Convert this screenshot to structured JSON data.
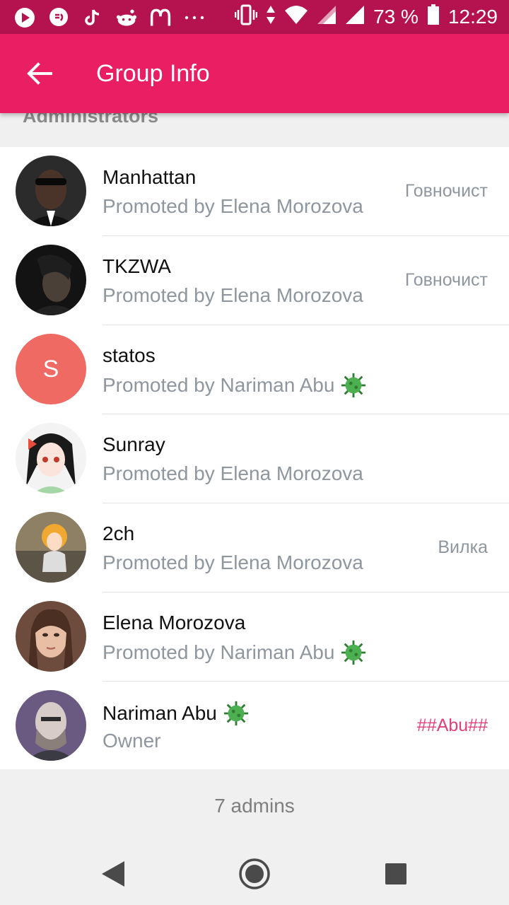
{
  "status_bar": {
    "battery_percent": "73 %",
    "time": "12:29",
    "left_icons": [
      "play-icon",
      "messenger-icon",
      "tiktok-icon",
      "reddit-icon",
      "mcdonalds-icon",
      "more-icon"
    ],
    "right_icons": [
      "vibrate-icon",
      "data-arrows-icon",
      "wifi-icon",
      "signal-icon",
      "signal-icon",
      "battery-icon"
    ]
  },
  "app_bar": {
    "title": "Group Info",
    "back_icon": "arrow-left-icon"
  },
  "section_title": "Administrators",
  "admins": [
    {
      "name": "Manhattan",
      "subtitle": "Promoted by Elena Morozova",
      "rank": "Говночист",
      "has_virus_sub": false,
      "has_virus_name": false
    },
    {
      "name": "TKZWA",
      "subtitle": "Promoted by Elena Morozova",
      "rank": "Говночист",
      "has_virus_sub": false,
      "has_virus_name": false
    },
    {
      "name": "statos",
      "subtitle": "Promoted by Nariman Abu",
      "rank": "",
      "has_virus_sub": true,
      "has_virus_name": false,
      "avatar_letter": "S"
    },
    {
      "name": "Sunray",
      "subtitle": "Promoted by Elena Morozova",
      "rank": "",
      "has_virus_sub": false,
      "has_virus_name": false
    },
    {
      "name": "2ch",
      "subtitle": "Promoted by Elena Morozova",
      "rank": "Вилка",
      "has_virus_sub": false,
      "has_virus_name": false
    },
    {
      "name": "Elena Morozova",
      "subtitle": "Promoted by Nariman Abu",
      "rank": "",
      "has_virus_sub": true,
      "has_virus_name": false
    },
    {
      "name": "Nariman Abu",
      "subtitle": "Owner",
      "rank": "##Abu##",
      "has_virus_sub": false,
      "has_virus_name": true
    }
  ],
  "footer": {
    "count_text": "7 admins"
  },
  "colors": {
    "status_bar": "#b5134f",
    "app_bar": "#e91e63",
    "owner_rank": "#e2407a",
    "subtitle": "#8f969e"
  }
}
